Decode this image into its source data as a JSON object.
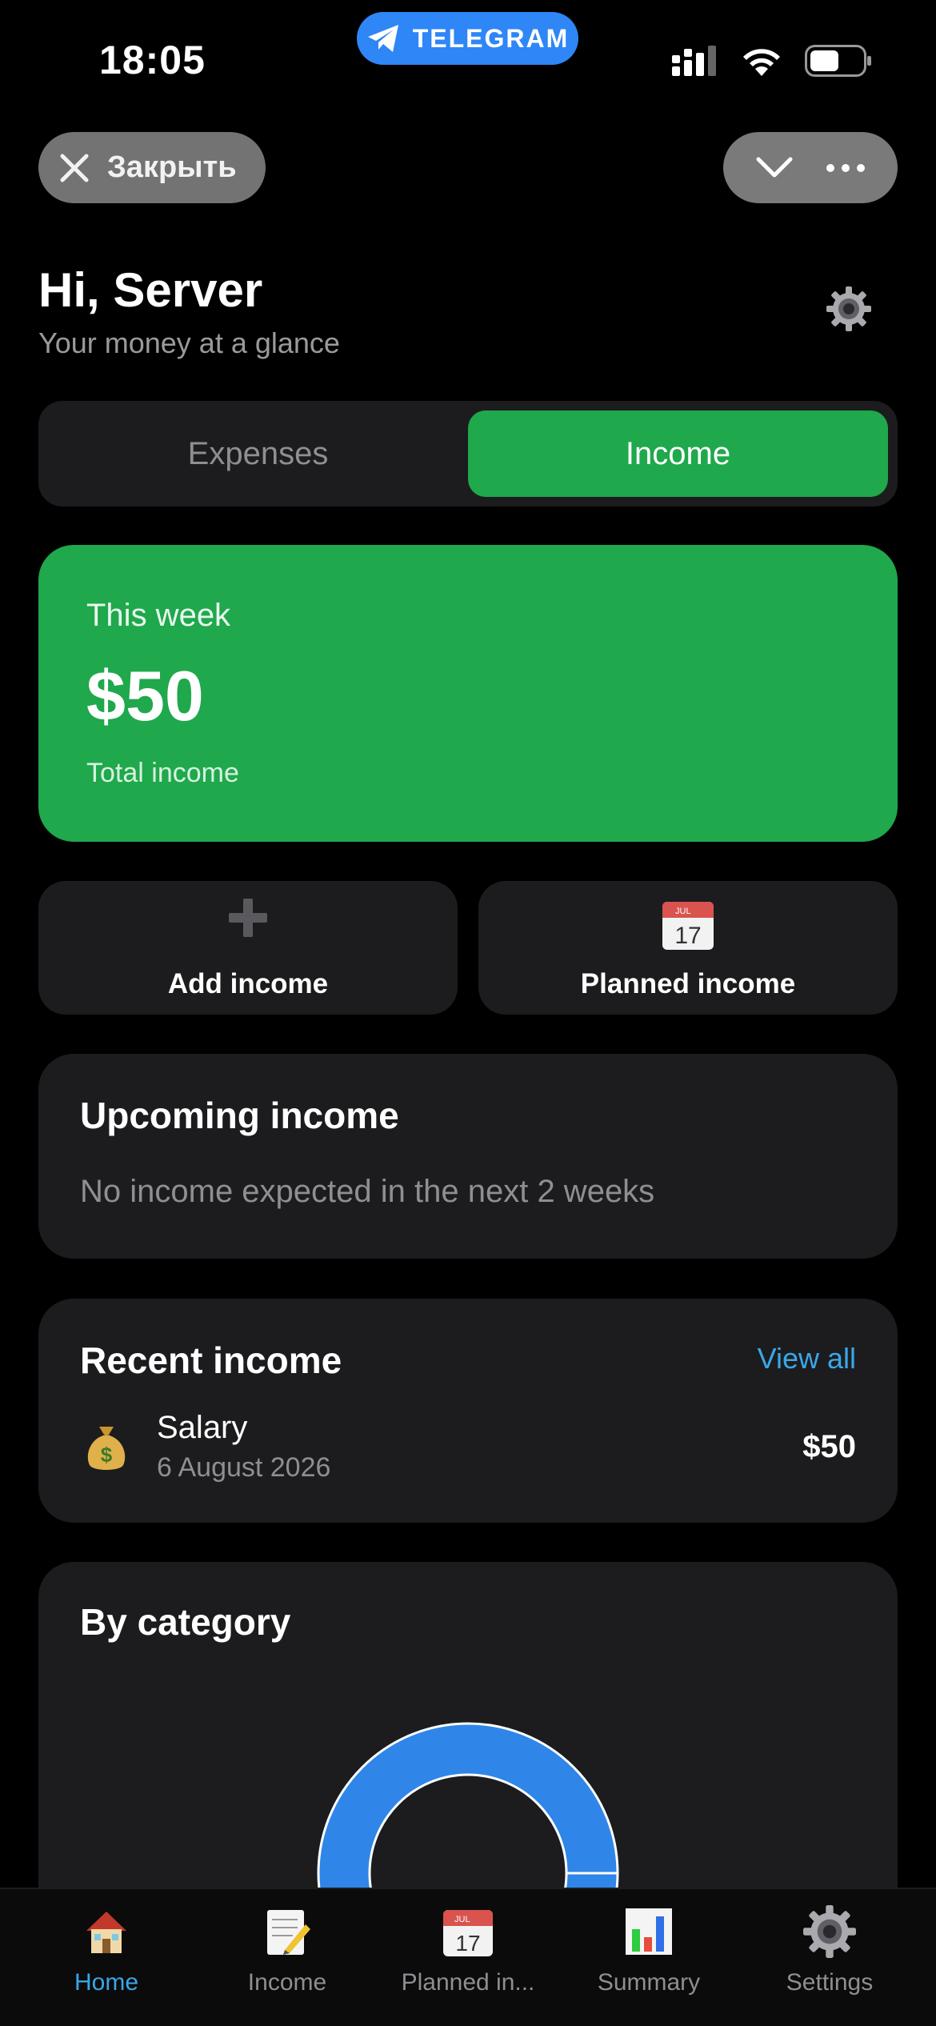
{
  "status_bar": {
    "time": "18:05",
    "app_pill": "TELEGRAM",
    "battery_level": 0.55
  },
  "top_buttons": {
    "close_label": "Закрыть"
  },
  "header": {
    "greeting": "Hi, Server",
    "subtitle": "Your money at a glance"
  },
  "segmented": {
    "expenses_label": "Expenses",
    "income_label": "Income",
    "selected": "Income"
  },
  "summary": {
    "period": "This week",
    "amount": "$50",
    "caption": "Total income"
  },
  "actions": {
    "add_label": "Add income",
    "planned_label": "Planned income",
    "calendar_month": "JUL",
    "calendar_day": "17"
  },
  "upcoming": {
    "title": "Upcoming income",
    "empty_text": "No income expected in the next 2 weeks"
  },
  "recent": {
    "title": "Recent income",
    "view_all": "View all",
    "items": [
      {
        "icon": "money-bag-icon",
        "name": "Salary",
        "date": "6 August 2026",
        "amount": "$50"
      }
    ]
  },
  "category": {
    "title": "By category",
    "color": "#2f86e8"
  },
  "tabbar": {
    "items": [
      {
        "label": "Home",
        "icon": "house-icon",
        "active": true
      },
      {
        "label": "Income",
        "icon": "memo-icon",
        "active": false
      },
      {
        "label": "Planned in...",
        "icon": "calendar-icon",
        "active": false
      },
      {
        "label": "Summary",
        "icon": "bar-chart-icon",
        "active": false
      },
      {
        "label": "Settings",
        "icon": "gear-icon",
        "active": false
      }
    ]
  },
  "colors": {
    "accent_green": "#1fa84c",
    "link_blue": "#3aa7e8",
    "card_bg": "#1c1c1e"
  }
}
